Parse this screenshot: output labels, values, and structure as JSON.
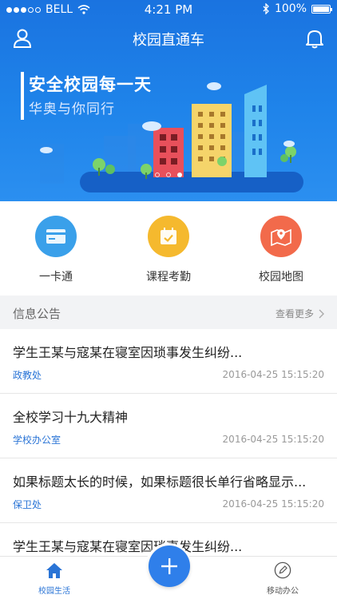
{
  "status_bar": {
    "carrier": "BELL",
    "time": "4:21 PM",
    "battery": "100%"
  },
  "header": {
    "title": "校园直通车",
    "user_icon": "user-icon",
    "bell_icon": "bell-icon"
  },
  "banner": {
    "headline": "安全校园每一天",
    "subtitle": "华奥与你同行",
    "pages": 3,
    "active_page": 3
  },
  "quick_actions": [
    {
      "label": "一卡通",
      "icon": "card-icon",
      "color": "#3aa0ea"
    },
    {
      "label": "课程考勤",
      "icon": "calendar-check-icon",
      "color": "#f5b92e"
    },
    {
      "label": "校园地图",
      "icon": "map-pin-icon",
      "color": "#f26a4b"
    }
  ],
  "notices": {
    "title": "信息公告",
    "more_label": "查看更多",
    "items": [
      {
        "title": "学生王某与寇某在寝室因琐事发生纠纷...",
        "dept": "政教处",
        "time": "2016-04-25 15:15:20"
      },
      {
        "title": "全校学习十九大精神",
        "dept": "学校办公室",
        "time": "2016-04-25 15:15:20"
      },
      {
        "title": "如果标题太长的时候，如果标题很长单行省略显示...",
        "dept": "保卫处",
        "time": "2016-04-25 15:15:20"
      },
      {
        "title": "学生王某与寇某在寝室因琐事发生纠纷...",
        "dept": "",
        "time": ""
      }
    ]
  },
  "tabbar": {
    "home_label": "校园生活",
    "office_label": "移动办公",
    "add_icon": "plus-icon",
    "active_color": "#2a74d6"
  }
}
